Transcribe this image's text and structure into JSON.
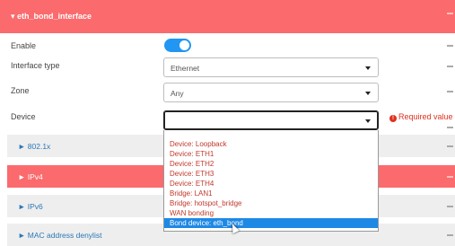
{
  "header": {
    "title": "▾ eth_bond_interface"
  },
  "fields": {
    "enable_label": "Enable",
    "enable_on": true,
    "interface_type_label": "Interface type",
    "interface_type_value": "Ethernet",
    "zone_label": "Zone",
    "zone_value": "Any",
    "device_label": "Device",
    "device_value": "",
    "required_text": "Required value",
    "required_icon": "exclamation-circle-icon"
  },
  "sections": [
    {
      "label": "► 802.1x",
      "highlight": false
    },
    {
      "label": "► IPv4",
      "highlight": true
    },
    {
      "label": "► IPv6",
      "highlight": false
    },
    {
      "label": "► MAC address denylist",
      "highlight": false
    }
  ],
  "dropdown": {
    "options": [
      "Device: Loopback",
      "Device: ETH1",
      "Device: ETH2",
      "Device: ETH3",
      "Device: ETH4",
      "Bridge: LAN1",
      "Bridge: hotspot_bridge",
      "WAN bonding",
      "Bond device: eth_bond"
    ],
    "selected": "Bond device: eth_bond"
  },
  "colors": {
    "accent_red": "#fb6a6d",
    "toggle_blue": "#2196f3",
    "error_red": "#e0301e",
    "option_red": "#c0392b",
    "selected_blue": "#1e88e5"
  }
}
